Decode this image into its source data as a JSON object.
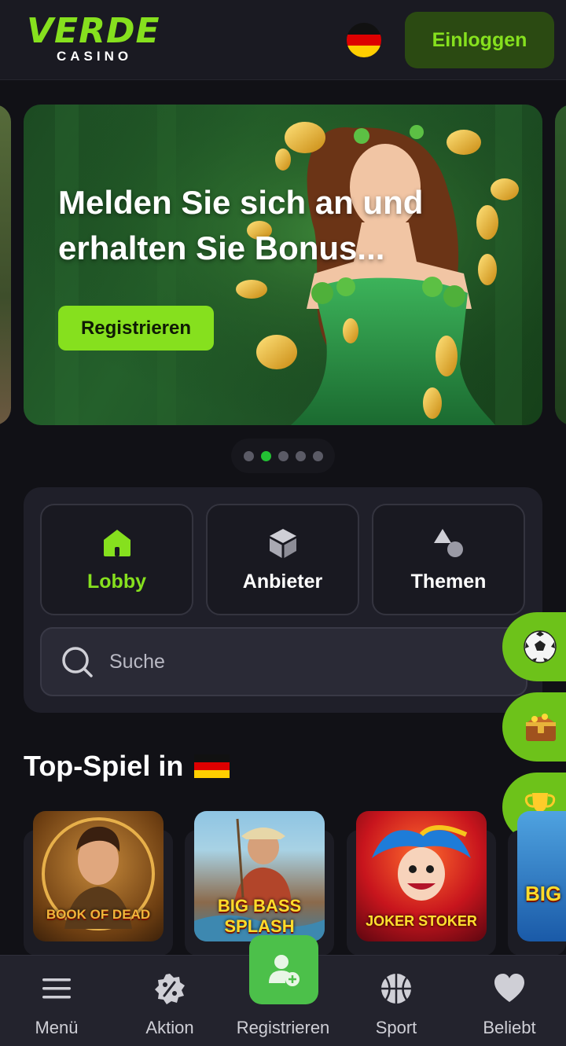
{
  "header": {
    "logo_main": "VERDE",
    "logo_sub": "CASINO",
    "language_flag": "germany-flag-icon",
    "login_label": "Einloggen"
  },
  "hero": {
    "title": "Melden Sie sich an und erhalten Sie Bonus...",
    "cta_label": "Registrieren",
    "slide_count": 5,
    "active_slide": 2
  },
  "categories": {
    "items": [
      {
        "label": "Lobby",
        "icon": "home-icon",
        "active": true
      },
      {
        "label": "Anbieter",
        "icon": "cube-icon",
        "active": false
      },
      {
        "label": "Themen",
        "icon": "shapes-icon",
        "active": false
      }
    ],
    "search_placeholder": "Suche"
  },
  "side_buttons": [
    {
      "icon": "soccer-ball-icon"
    },
    {
      "icon": "treasure-chest-icon"
    },
    {
      "icon": "trophy-icon"
    }
  ],
  "top_games": {
    "title": "Top-Spiel in",
    "flag": "germany-flag-icon",
    "games": [
      {
        "name": "BOOK OF DEAD"
      },
      {
        "name": "BIG BASS SPLASH"
      },
      {
        "name": "JOKER STOKER"
      },
      {
        "name": "BIG"
      }
    ]
  },
  "bottom_nav": {
    "items": [
      {
        "label": "Menü",
        "icon": "menu-icon"
      },
      {
        "label": "Aktion",
        "icon": "discount-badge-icon"
      },
      {
        "label": "Registrieren",
        "icon": "add-user-icon"
      },
      {
        "label": "Sport",
        "icon": "basketball-icon"
      },
      {
        "label": "Beliebt",
        "icon": "heart-icon"
      }
    ]
  },
  "colors": {
    "accent": "#86e01e",
    "background": "#111116",
    "panel": "#1f1f29",
    "active_dot": "#23c134"
  }
}
